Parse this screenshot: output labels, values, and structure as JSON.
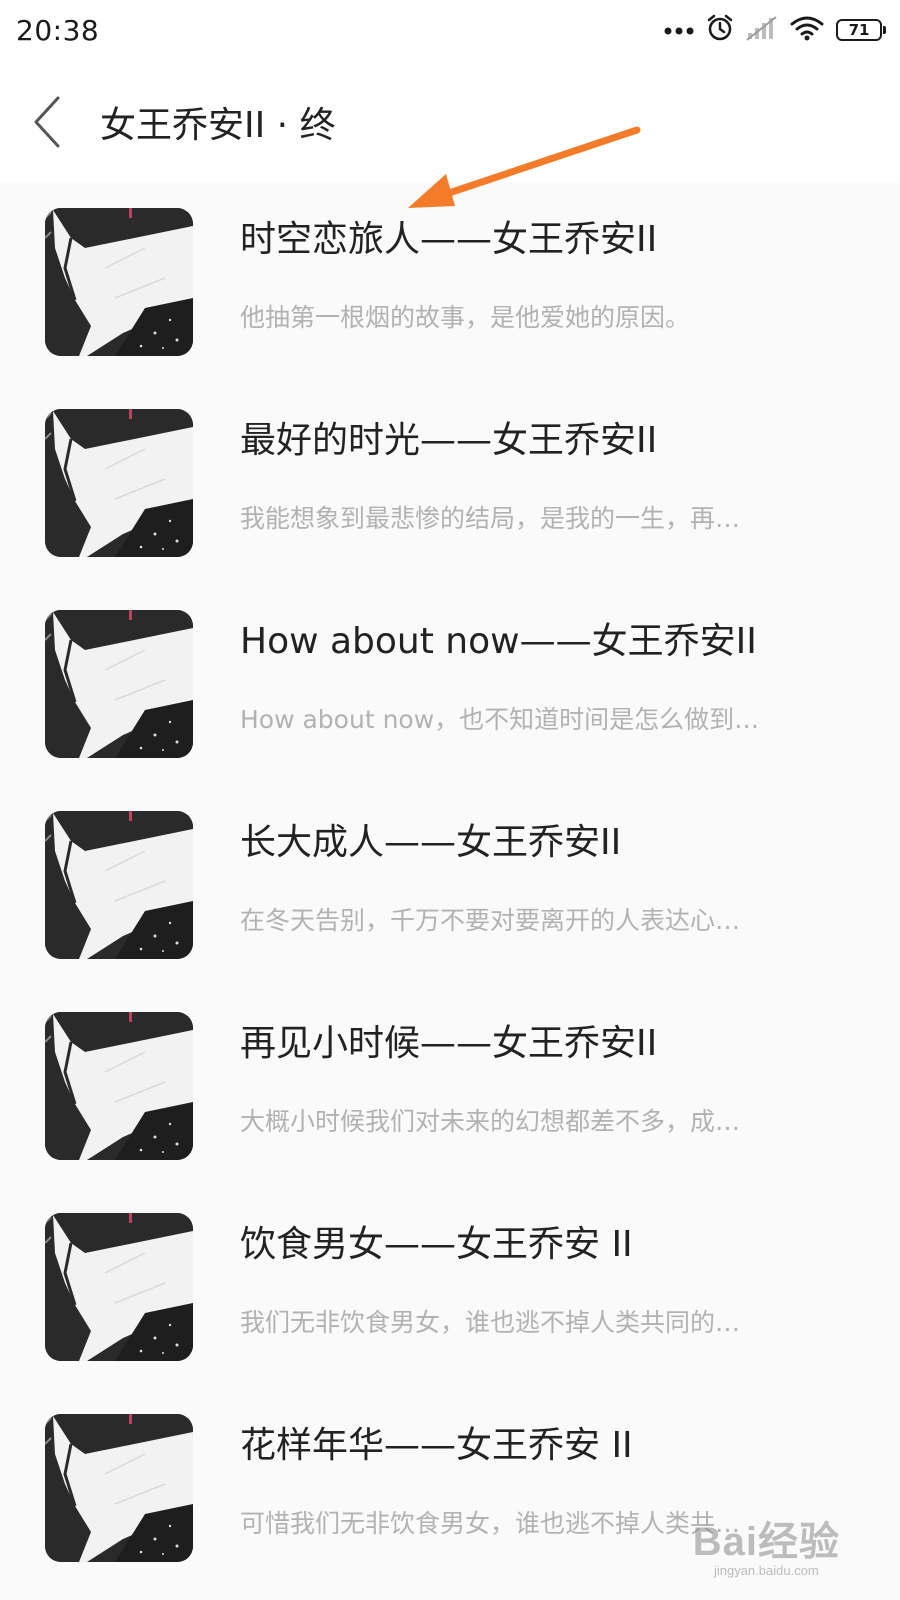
{
  "status_bar": {
    "time": "20:38",
    "battery": "71",
    "icons": [
      "more-dots-icon",
      "alarm-icon",
      "signal-icon",
      "wifi-icon",
      "battery-icon"
    ]
  },
  "header": {
    "title": "女王乔安II · 终",
    "back_icon": "chevron-left-icon"
  },
  "songs": [
    {
      "title": "时空恋旅人——女王乔安II",
      "desc": "他抽第一根烟的故事，是他爱她的原因。"
    },
    {
      "title": "最好的时光——女王乔安II",
      "desc": "我能想象到最悲惨的结局，是我的一生，再…"
    },
    {
      "title": "How about now——女王乔安II",
      "desc": "How about now，也不知道时间是怎么做到…"
    },
    {
      "title": "长大成人——女王乔安II",
      "desc": "在冬天告别，千万不要对要离开的人表达心…"
    },
    {
      "title": "再见小时候——女王乔安II",
      "desc": "大概小时候我们对未来的幻想都差不多，成…"
    },
    {
      "title": "饮食男女——女王乔安 II",
      "desc": "我们无非饮食男女，谁也逃不掉人类共同的…"
    },
    {
      "title": "花样年华——女王乔安 II",
      "desc": "可惜我们无非饮食男女，谁也逃不掉人类共…"
    }
  ],
  "annotation": {
    "arrow_color": "#f47b2a"
  },
  "watermark": {
    "main": "Bai经验",
    "sub": "jingyan.baidu.com"
  }
}
